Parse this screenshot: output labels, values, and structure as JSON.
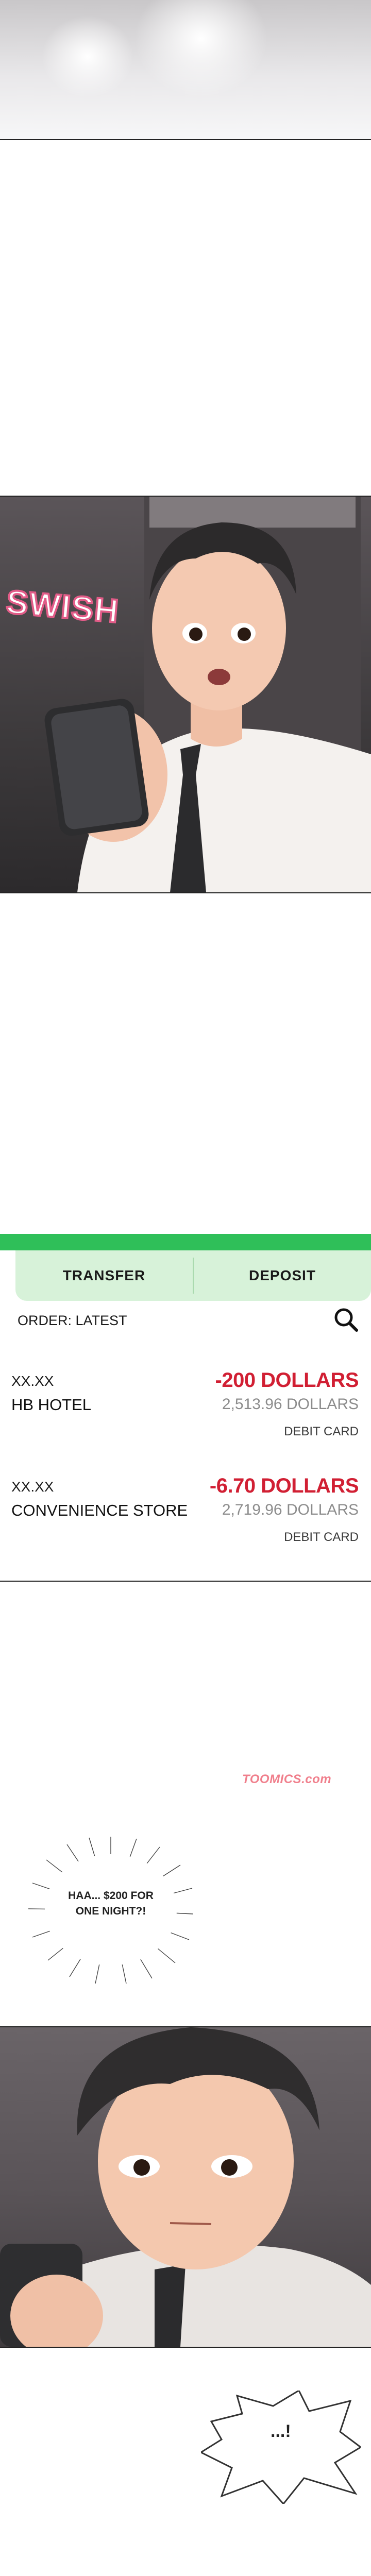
{
  "sfx": {
    "swish": "SWISH"
  },
  "bank": {
    "tabs": [
      "TRANSFER",
      "DEPOSIT"
    ],
    "order_label": "ORDER: LATEST",
    "search_icon": "search-icon",
    "colors": {
      "accent": "#2fbf59",
      "tab_bg": "#d7f2d9",
      "debit": "#d11f33",
      "balance": "#8c8c8c"
    },
    "transactions": [
      {
        "date": "XX.XX",
        "merchant": "HB HOTEL",
        "amount": "-200 DOLLARS",
        "balance": "2,513.96 DOLLARS",
        "card": "DEBIT CARD"
      },
      {
        "date": "XX.XX",
        "merchant": "CONVENIENCE STORE",
        "amount": "-6.70 DOLLARS",
        "balance": "2,719.96 DOLLARS",
        "card": "DEBIT CARD"
      }
    ]
  },
  "watermark": "TOOMICS.com",
  "dialogue": {
    "burst1": "HAA... $200 FOR ONE NIGHT?!",
    "burst2": "...!"
  }
}
